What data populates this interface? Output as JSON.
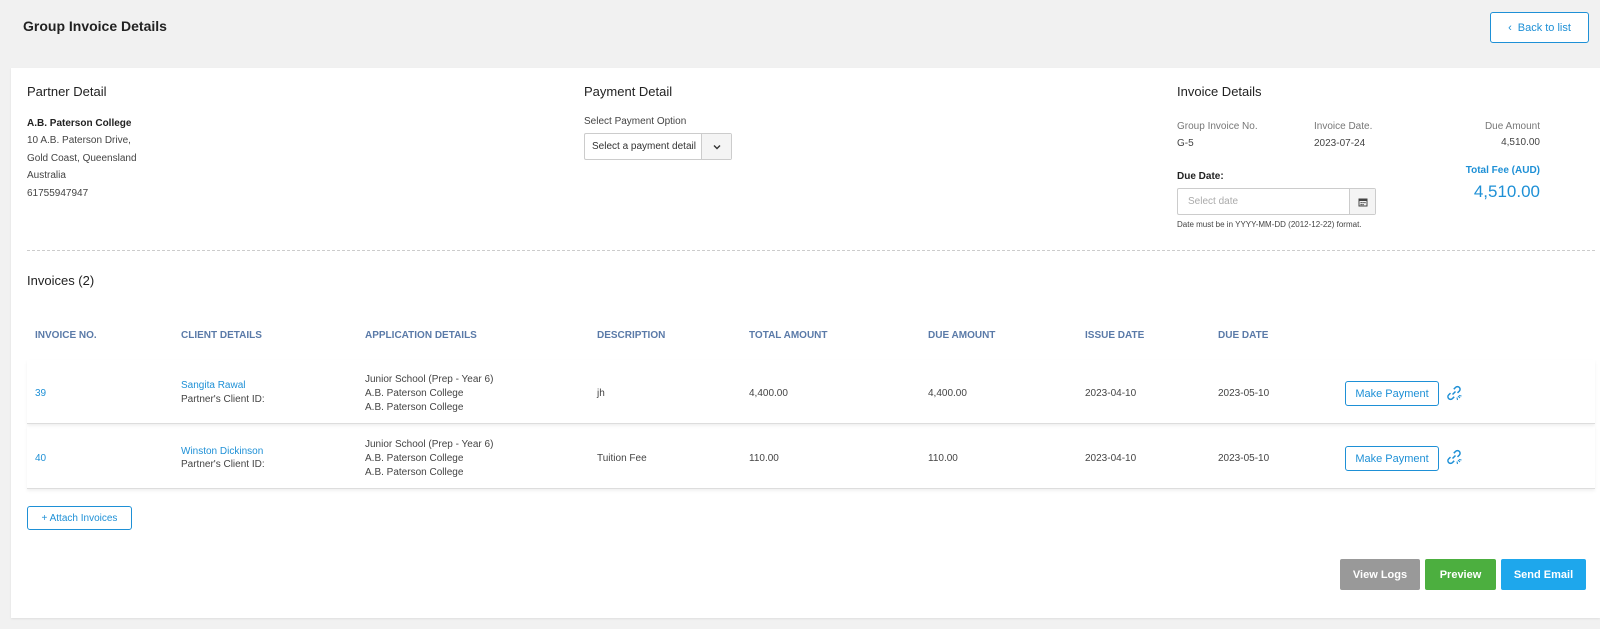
{
  "header": {
    "title": "Group Invoice Details",
    "back_label": "Back to list"
  },
  "partner": {
    "section_title": "Partner Detail",
    "name": "A.B. Paterson College",
    "lines": [
      "10 A.B. Paterson Drive,",
      "Gold Coast, Queensland",
      "Australia",
      "61755947947"
    ]
  },
  "payment": {
    "section_title": "Payment Detail",
    "option_label": "Select Payment Option",
    "select_value": "Select a payment detail"
  },
  "invoice_details": {
    "section_title": "Invoice Details",
    "group_no_label": "Group Invoice No.",
    "group_no": "G-5",
    "invoice_date_label": "Invoice Date.",
    "invoice_date": "2023-07-24",
    "due_amount_label": "Due Amount",
    "due_amount": "4,510.00",
    "due_date_label": "Due Date:",
    "due_date_placeholder": "Select date",
    "date_hint": "Date must be in YYYY-MM-DD (2012-12-22) format.",
    "total_fee_label": "Total Fee (AUD)",
    "total_fee": "4,510.00"
  },
  "invoices": {
    "heading": "Invoices (2)",
    "columns": [
      "INVOICE NO.",
      "CLIENT DETAILS",
      "APPLICATION DETAILS",
      "DESCRIPTION",
      "TOTAL AMOUNT",
      "DUE AMOUNT",
      "ISSUE DATE",
      "DUE DATE"
    ],
    "rows": [
      {
        "no": "39",
        "client_name": "Sangita Rawal",
        "client_id": "Partner's Client ID:",
        "app": [
          "Junior School (Prep - Year 6)",
          "A.B. Paterson College",
          "A.B. Paterson College"
        ],
        "description": "jh",
        "total": "4,400.00",
        "due": "4,400.00",
        "issue_date": "2023-04-10",
        "due_date": "2023-05-10",
        "action": "Make Payment"
      },
      {
        "no": "40",
        "client_name": "Winston Dickinson",
        "client_id": "Partner's Client ID:",
        "app": [
          "Junior School (Prep - Year 6)",
          "A.B. Paterson College",
          "A.B. Paterson College"
        ],
        "description": "Tuition Fee",
        "total": "110.00",
        "due": "110.00",
        "issue_date": "2023-04-10",
        "due_date": "2023-05-10",
        "action": "Make Payment"
      }
    ],
    "attach_label": "+ Attach Invoices"
  },
  "actions": {
    "view_logs": "View Logs",
    "preview": "Preview",
    "send_email": "Send Email"
  },
  "colors": {
    "accent": "#1e90d6",
    "view_logs": "#999999",
    "preview": "#4caf3f",
    "send_email": "#1ea7ec"
  }
}
